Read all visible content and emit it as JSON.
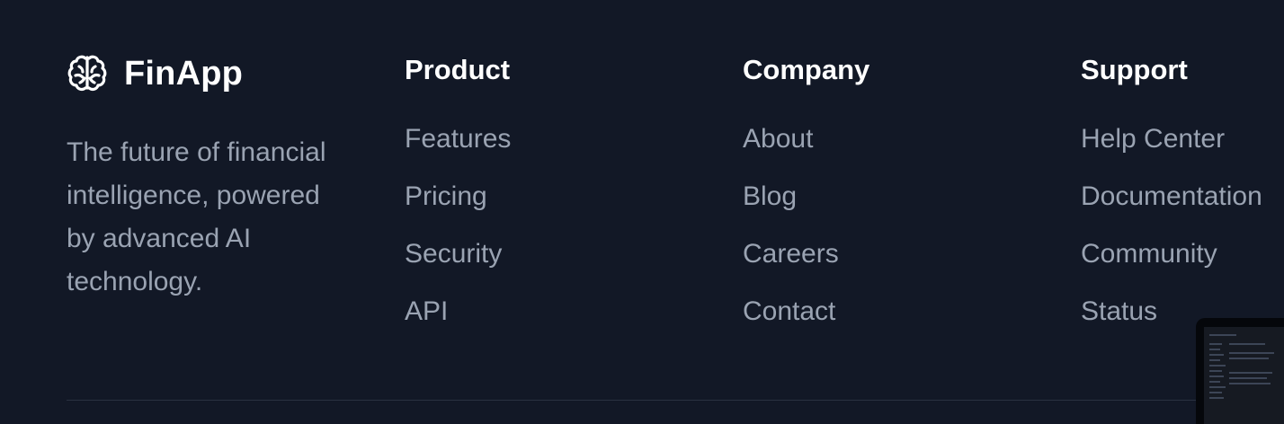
{
  "brand": {
    "name": "FinApp",
    "tagline": "The future of financial intelligence, powered by advanced AI technology.",
    "icon": "brain-icon"
  },
  "columns": [
    {
      "heading": "Product",
      "links": [
        "Features",
        "Pricing",
        "Security",
        "API"
      ]
    },
    {
      "heading": "Company",
      "links": [
        "About",
        "Blog",
        "Careers",
        "Contact"
      ]
    },
    {
      "heading": "Support",
      "links": [
        "Help Center",
        "Documentation",
        "Community",
        "Status"
      ]
    }
  ],
  "colors": {
    "background": "#121826",
    "heading": "#ffffff",
    "link": "#9aa3b2",
    "divider": "#2a3140"
  }
}
